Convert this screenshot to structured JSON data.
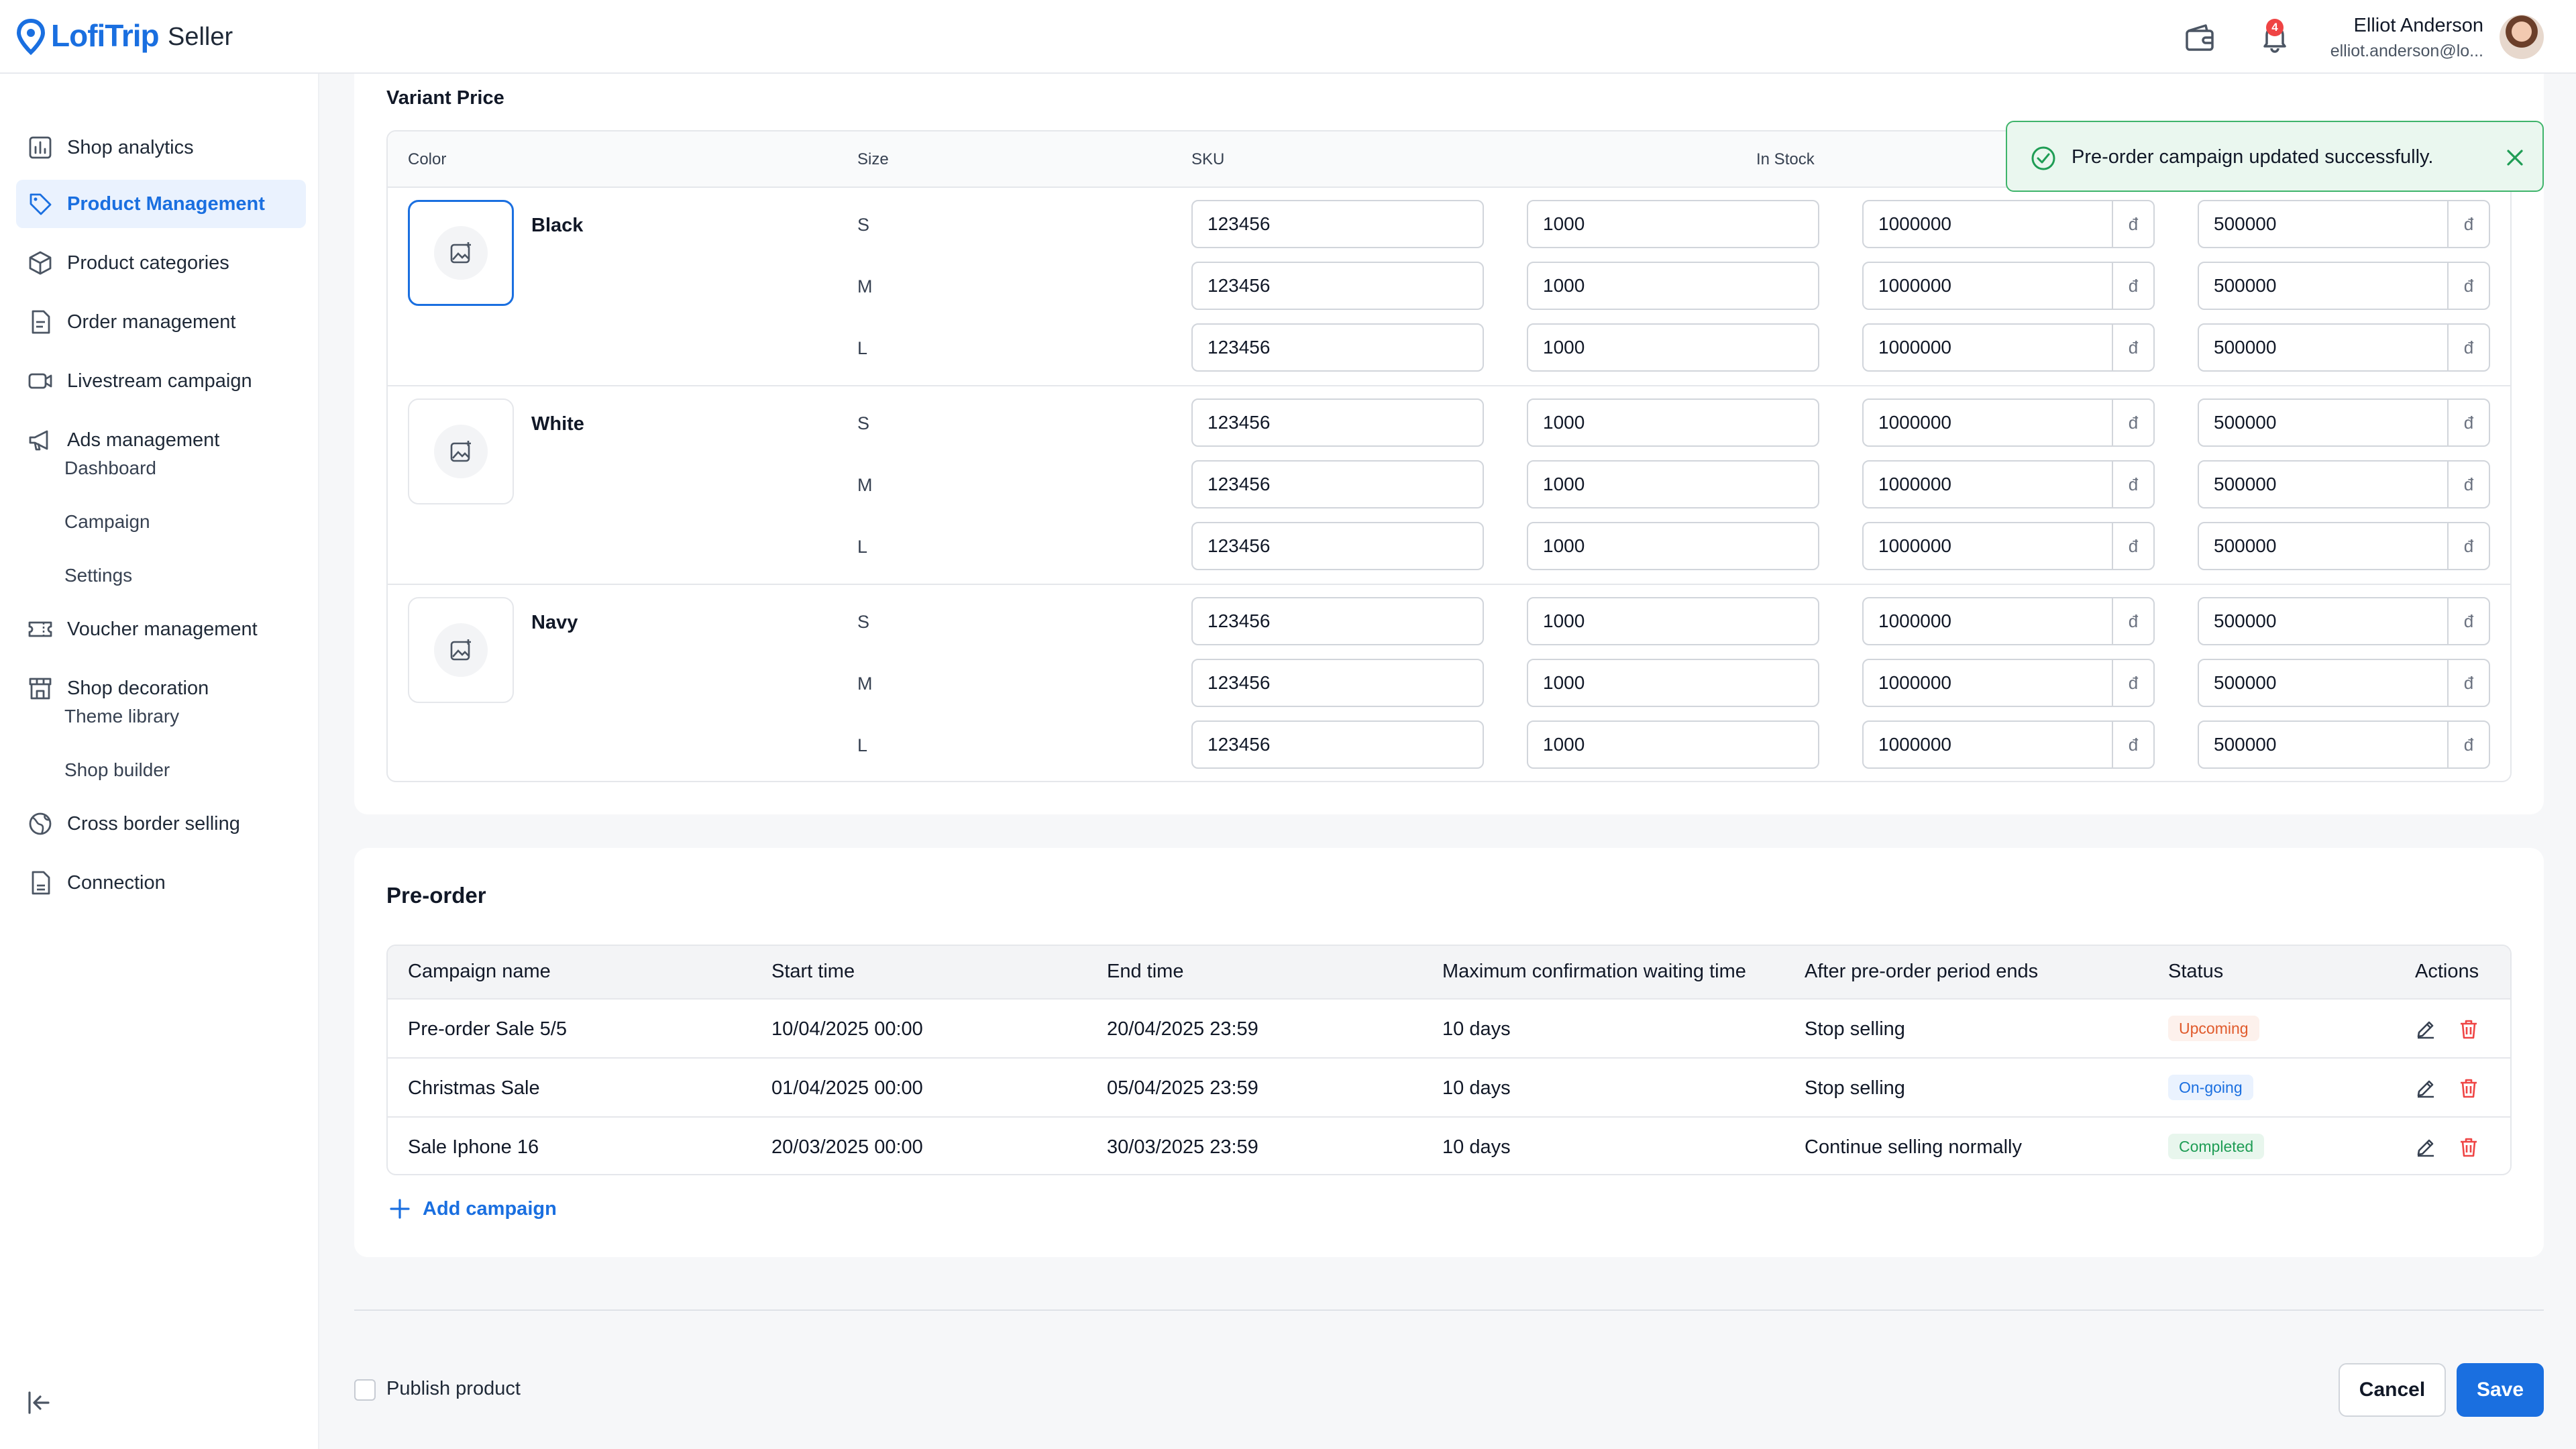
{
  "brand": {
    "name": "LofiTrip",
    "sub": "Seller",
    "accent": "#1a6fe0"
  },
  "header": {
    "notifications_count": "4",
    "user": {
      "name": "Elliot Anderson",
      "email": "elliot.anderson@lo..."
    }
  },
  "sidebar": {
    "items": [
      {
        "label": "Shop analytics",
        "icon": "chart-icon"
      },
      {
        "label": "Product Management",
        "icon": "tag-icon",
        "active": true
      },
      {
        "label": "Product categories",
        "icon": "box-icon"
      },
      {
        "label": "Order management",
        "icon": "document-icon"
      },
      {
        "label": "Livestream campaign",
        "icon": "video-icon"
      },
      {
        "label": "Ads management",
        "icon": "megaphone-icon"
      },
      {
        "label": "Voucher management",
        "icon": "ticket-icon"
      },
      {
        "label": "Shop decoration",
        "icon": "store-icon"
      },
      {
        "label": "Cross border selling",
        "icon": "globe-icon"
      },
      {
        "label": "Connection",
        "icon": "file-icon"
      }
    ],
    "ads_sub": [
      "Dashboard",
      "Campaign",
      "Settings"
    ],
    "decoration_sub": [
      "Theme library",
      "Shop builder"
    ]
  },
  "variant_price": {
    "title": "Variant Price",
    "headers": {
      "color": "Color",
      "size": "Size",
      "sku": "SKU",
      "in_stock": "In Stock"
    },
    "currency": "đ",
    "groups": [
      {
        "color": "Black",
        "rows": [
          {
            "size": "S",
            "sku": "123456",
            "stock": "1000",
            "price": "1000000",
            "sale": "500000"
          },
          {
            "size": "M",
            "sku": "123456",
            "stock": "1000",
            "price": "1000000",
            "sale": "500000"
          },
          {
            "size": "L",
            "sku": "123456",
            "stock": "1000",
            "price": "1000000",
            "sale": "500000"
          }
        ]
      },
      {
        "color": "White",
        "rows": [
          {
            "size": "S",
            "sku": "123456",
            "stock": "1000",
            "price": "1000000",
            "sale": "500000"
          },
          {
            "size": "M",
            "sku": "123456",
            "stock": "1000",
            "price": "1000000",
            "sale": "500000"
          },
          {
            "size": "L",
            "sku": "123456",
            "stock": "1000",
            "price": "1000000",
            "sale": "500000"
          }
        ]
      },
      {
        "color": "Navy",
        "rows": [
          {
            "size": "S",
            "sku": "123456",
            "stock": "1000",
            "price": "1000000",
            "sale": "500000"
          },
          {
            "size": "M",
            "sku": "123456",
            "stock": "1000",
            "price": "1000000",
            "sale": "500000"
          },
          {
            "size": "L",
            "sku": "123456",
            "stock": "1000",
            "price": "1000000",
            "sale": "500000"
          }
        ]
      }
    ]
  },
  "toast": {
    "message": "Pre-order campaign updated successfully."
  },
  "preorder": {
    "title": "Pre-order",
    "headers": {
      "name": "Campaign name",
      "start": "Start time",
      "end": "End time",
      "wait": "Maximum confirmation waiting time",
      "after": "After pre-order period ends",
      "status": "Status",
      "actions": "Actions"
    },
    "rows": [
      {
        "name": "Pre-order Sale 5/5",
        "start": "10/04/2025 00:00",
        "end": "20/04/2025 23:59",
        "wait": "10 days",
        "after": "Stop selling",
        "status": "Upcoming",
        "status_kind": "upcoming"
      },
      {
        "name": "Christmas Sale",
        "start": "01/04/2025 00:00",
        "end": "05/04/2025 23:59",
        "wait": "10 days",
        "after": "Stop selling",
        "status": "On-going",
        "status_kind": "ongoing"
      },
      {
        "name": "Sale Iphone 16",
        "start": "20/03/2025 00:00",
        "end": "30/03/2025 23:59",
        "wait": "10 days",
        "after": "Continue selling normally",
        "status": "Completed",
        "status_kind": "completed"
      }
    ],
    "add_label": "Add campaign"
  },
  "footer": {
    "publish_label": "Publish product",
    "cancel_label": "Cancel",
    "save_label": "Save"
  }
}
